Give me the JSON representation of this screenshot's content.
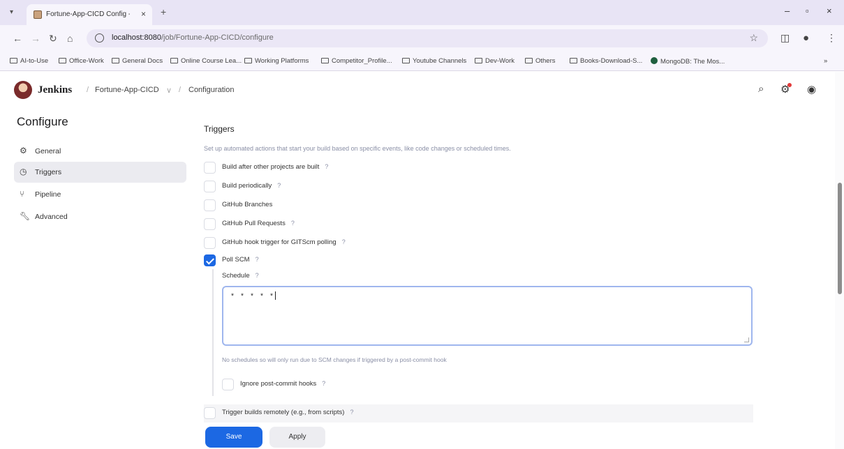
{
  "browser": {
    "tab_title": "Fortune-App-CICD Config - Je",
    "url_host": "localhost:8080",
    "url_path": "/job/Fortune-App-CICD/configure",
    "bookmarks": [
      "AI-to-Use",
      "Office-Work",
      "General Docs",
      "Online Course Lea...",
      "Working Platforms",
      "Competitor_Profile...",
      "Youtube Channels",
      "Dev-Work",
      "Others",
      "Books-Download-S...",
      "MongoDB: The Mos..."
    ]
  },
  "header": {
    "brand": "Jenkins",
    "breadcrumbs": [
      "Fortune-App-CICD",
      "Configuration"
    ]
  },
  "sidebar": {
    "title": "Configure",
    "items": [
      {
        "label": "General",
        "icon": "gear-icon"
      },
      {
        "label": "Triggers",
        "icon": "clock-icon",
        "active": true
      },
      {
        "label": "Pipeline",
        "icon": "pipeline-icon"
      },
      {
        "label": "Advanced",
        "icon": "wrench-icon"
      }
    ]
  },
  "triggers": {
    "title": "Triggers",
    "description": "Set up automated actions that start your build based on specific events, like code changes or scheduled times.",
    "options": [
      {
        "label": "Build after other projects are built",
        "checked": false
      },
      {
        "label": "Build periodically",
        "checked": false
      },
      {
        "label": "GitHub Branches",
        "checked": false
      },
      {
        "label": "GitHub Pull Requests",
        "checked": false
      },
      {
        "label": "GitHub hook trigger for GITScm polling",
        "checked": false
      },
      {
        "label": "Poll SCM",
        "checked": true
      }
    ],
    "help_icon": "?",
    "schedule": {
      "label": "Schedule",
      "value": "* * * * *",
      "note": "No schedules so will only run due to SCM changes if triggered by a post-commit hook"
    },
    "ignore_post_commit": {
      "label": "Ignore post-commit hooks",
      "checked": false
    },
    "trigger_remote": {
      "label": "Trigger builds remotely (e.g., from scripts)",
      "checked": false
    }
  },
  "actions": {
    "save_label": "Save",
    "apply_label": "Apply"
  },
  "colors": {
    "accent": "#1c68e3",
    "chrome": "#e8e4f5"
  }
}
